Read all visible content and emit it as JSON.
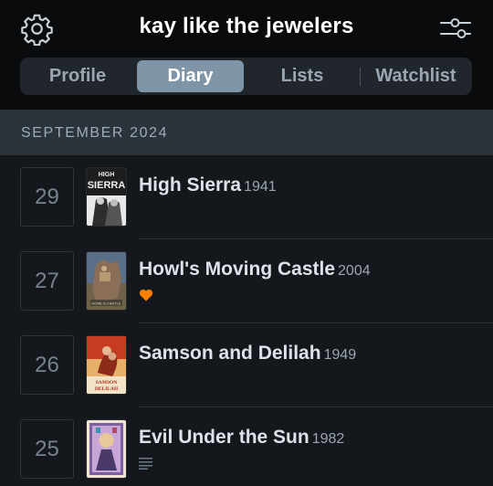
{
  "header": {
    "title": "kay like the jewelers",
    "settings_icon": "gear-icon",
    "filter_icon": "sliders-icon"
  },
  "tabs": [
    {
      "label": "Profile",
      "active": false
    },
    {
      "label": "Diary",
      "active": true
    },
    {
      "label": "Lists",
      "active": false
    },
    {
      "label": "Watchlist",
      "active": false
    }
  ],
  "section": {
    "label": "SEPTEMBER 2024"
  },
  "entries": [
    {
      "day": "29",
      "title": "High Sierra",
      "year": "1941",
      "liked": false,
      "has_review": false,
      "poster_text": "HIGH SIERRA"
    },
    {
      "day": "27",
      "title": "Howl's Moving Castle",
      "year": "2004",
      "liked": true,
      "has_review": false,
      "poster_text": "HOWL'S MOVING CASTLE"
    },
    {
      "day": "26",
      "title": "Samson and Delilah",
      "year": "1949",
      "liked": false,
      "has_review": false,
      "poster_text": "SAMSON DELILAH"
    },
    {
      "day": "25",
      "title": "Evil Under the Sun",
      "year": "1982",
      "liked": false,
      "has_review": true,
      "poster_text": ""
    }
  ],
  "colors": {
    "background": "#14181c",
    "header_bg": "#0a0b0d",
    "active_tab": "#8094a8",
    "like_heart": "#ff8000"
  }
}
